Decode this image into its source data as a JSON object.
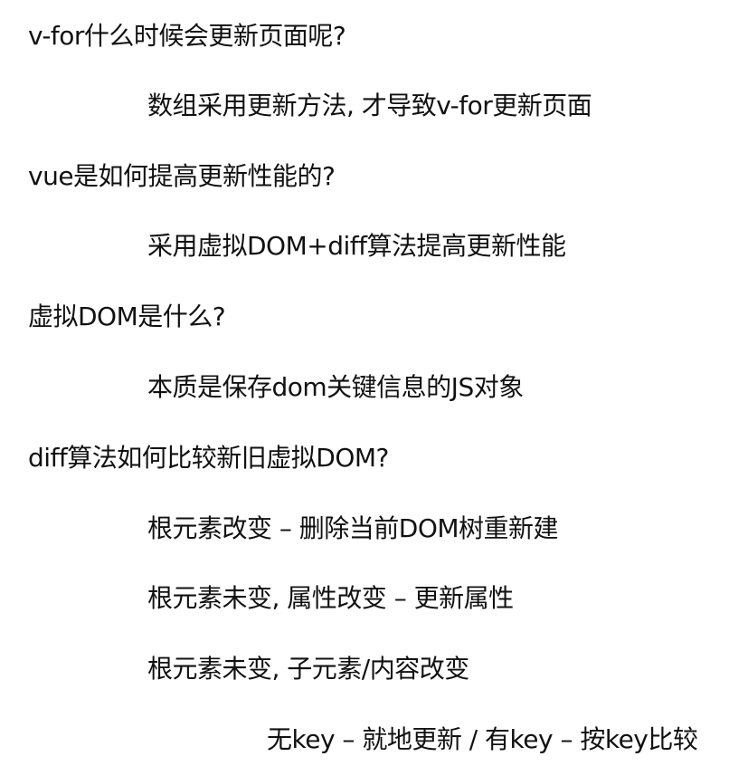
{
  "notes": [
    {
      "kind": "question",
      "text": "v-for什么时候会更新页面呢?"
    },
    {
      "kind": "answer",
      "text": "数组采用更新方法, 才导致v-for更新页面"
    },
    {
      "kind": "question",
      "text": "vue是如何提高更新性能的?"
    },
    {
      "kind": "answer",
      "text": "采用虚拟DOM+diff算法提高更新性能"
    },
    {
      "kind": "question",
      "text": "虚拟DOM是什么?"
    },
    {
      "kind": "answer",
      "text": "本质是保存dom关键信息的JS对象"
    },
    {
      "kind": "question",
      "text": "diff算法如何比较新旧虚拟DOM?"
    },
    {
      "kind": "answer",
      "text": "根元素改变 – 删除当前DOM树重新建"
    },
    {
      "kind": "answer",
      "text": "根元素未变, 属性改变 – 更新属性"
    },
    {
      "kind": "answer",
      "text": "根元素未变, 子元素/内容改变"
    },
    {
      "kind": "sub-answer",
      "text": "无key – 就地更新 / 有key – 按key比较"
    }
  ]
}
